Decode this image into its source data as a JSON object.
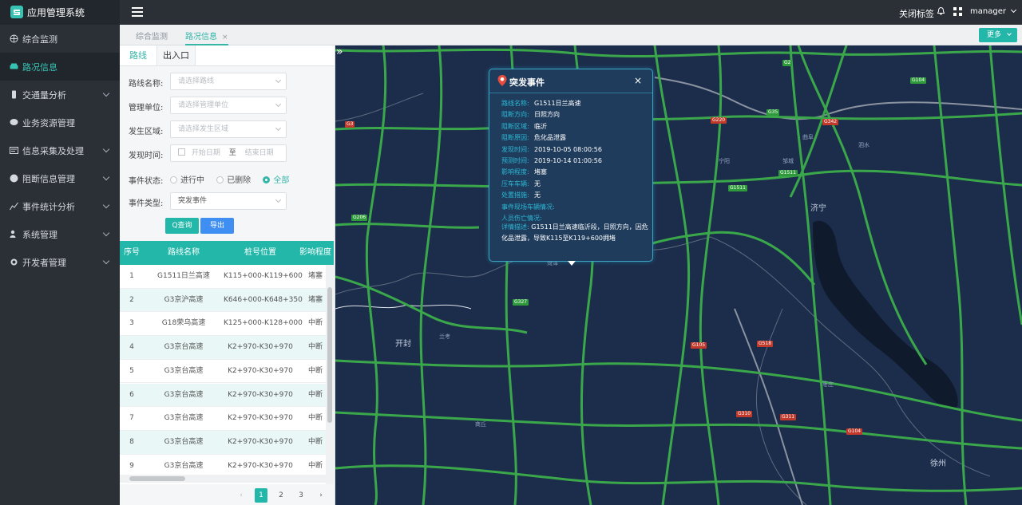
{
  "app": {
    "title": "应用管理系统"
  },
  "header": {
    "close_tabs": "关闭标签",
    "user": "manager"
  },
  "sidebar": {
    "items": [
      {
        "label": "综合监测",
        "icon": "globe-icon",
        "has_children": false,
        "active": false
      },
      {
        "label": "路况信息",
        "icon": "car-icon",
        "has_children": false,
        "active": true
      },
      {
        "label": "交通量分析",
        "icon": "traffic-icon",
        "has_children": true,
        "active": false
      },
      {
        "label": "业务资源管理",
        "icon": "chat-icon",
        "has_children": false,
        "active": false
      },
      {
        "label": "信息采集及处理",
        "icon": "collect-icon",
        "has_children": true,
        "active": false
      },
      {
        "label": "阻断信息管理",
        "icon": "block-icon",
        "has_children": true,
        "active": false
      },
      {
        "label": "事件统计分析",
        "icon": "chart-icon",
        "has_children": true,
        "active": false
      },
      {
        "label": "系统管理",
        "icon": "users-icon",
        "has_children": true,
        "active": false
      },
      {
        "label": "开发者管理",
        "icon": "dev-icon",
        "has_children": true,
        "active": false
      }
    ]
  },
  "page_tabs": [
    {
      "label": "综合监测",
      "active": false
    },
    {
      "label": "路况信息",
      "active": true,
      "closable": "×"
    }
  ],
  "more_button": "更多",
  "panel": {
    "tabs": [
      "路线",
      "出入口"
    ],
    "form": {
      "route_label": "路线名称:",
      "route_placeholder": "请选择路线",
      "unit_label": "管理单位:",
      "unit_placeholder": "请选择管理单位",
      "area_label": "发生区域:",
      "area_placeholder": "请选择发生区域",
      "time_label": "发现时间:",
      "start_placeholder": "开始日期",
      "to": "至",
      "end_placeholder": "结束日期",
      "status_label": "事件状态:",
      "status_options": [
        "进行中",
        "已删除",
        "全部"
      ],
      "status_selected": "全部",
      "type_label": "事件类型:",
      "type_value": "突发事件"
    },
    "buttons": {
      "query": "Q查询",
      "export": "导出"
    },
    "table": {
      "headers": [
        "序号",
        "路线名称",
        "桩号位置",
        "影响程度"
      ],
      "rows": [
        [
          "1",
          "G1511日兰高速",
          "K115+000-K119+600",
          "堵塞"
        ],
        [
          "2",
          "G3京沪高速",
          "K646+000-K648+350",
          "堵塞"
        ],
        [
          "3",
          "G18荣乌高速",
          "K125+000-K128+000",
          "中断"
        ],
        [
          "4",
          "G3京台高速",
          "K2+970-K30+970",
          "中断"
        ],
        [
          "5",
          "G3京台高速",
          "K2+970-K30+970",
          "中断"
        ],
        [
          "6",
          "G3京台高速",
          "K2+970-K30+970",
          "中断"
        ],
        [
          "7",
          "G3京台高速",
          "K2+970-K30+970",
          "中断"
        ],
        [
          "8",
          "G3京台高速",
          "K2+970-K30+970",
          "中断"
        ],
        [
          "9",
          "G3京台高速",
          "K2+970-K30+970",
          "中断"
        ]
      ]
    },
    "pager": {
      "prev": "‹",
      "pages": [
        "1",
        "2",
        "3"
      ],
      "current": "1",
      "next": "›"
    }
  },
  "popup": {
    "title": "突发事件",
    "close": "×",
    "fields": [
      {
        "k": "路线名称:",
        "v": "G1511日兰高速"
      },
      {
        "k": "阻断方向:",
        "v": "日照方向"
      },
      {
        "k": "阻断区域:",
        "v": "临沂"
      },
      {
        "k": "阻断原因:",
        "v": "危化品泄露"
      },
      {
        "k": "发现时间:",
        "v": "2019-10-05 08:00:56"
      },
      {
        "k": "预测时间:",
        "v": "2019-10-14 01:00:56"
      },
      {
        "k": "影响程度:",
        "v": "堵塞"
      },
      {
        "k": "压车车辆:",
        "v": "无"
      },
      {
        "k": "处置措施:",
        "v": "无"
      },
      {
        "k": "事件现场车辆情况:",
        "v": ""
      },
      {
        "k": "人员伤亡情况:",
        "v": ""
      }
    ],
    "desc_label": "详情描述:",
    "desc": "G1511日兰高速临沂段，日照方向，因危化品泄露，导致K115至K119+600拥堵"
  },
  "map": {
    "labels": [
      "济宁",
      "开封",
      "徐州",
      "菏泽",
      "兰考",
      "商丘",
      "枣庄",
      "邹城",
      "曲阜",
      "泗水",
      "宁阳"
    ],
    "shields": [
      "G35",
      "G220",
      "G342",
      "G3",
      "G1511",
      "G1511",
      "G105",
      "G518",
      "G310",
      "G311",
      "G104",
      "G206",
      "G327",
      "G2",
      "G104"
    ]
  },
  "colors": {
    "accent": "#22b7a8",
    "sidebar": "#2b3037",
    "map_bg": "#1c2d4b",
    "road": "#3aa84a"
  }
}
